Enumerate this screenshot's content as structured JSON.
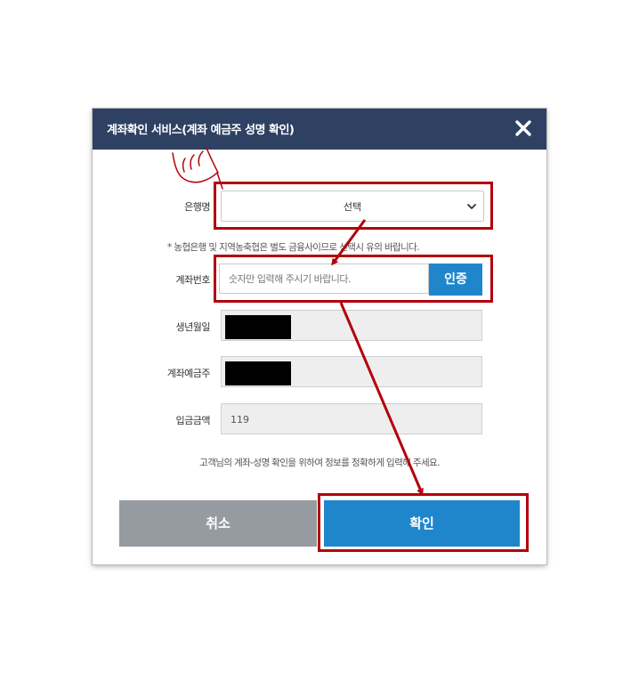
{
  "dialog": {
    "title": "계좌확인 서비스(계좌 예금주 성명 확인)",
    "close_icon": "close-icon"
  },
  "bank": {
    "label": "은행명",
    "selected": "선택"
  },
  "notice": "* 농협은행 및 지역농축협은 별도 금융사이므로 선택시 유의 바랍니다.",
  "account": {
    "label": "계좌번호",
    "placeholder": "숫자만 입력해 주시기 바랍니다.",
    "verify_label": "인증"
  },
  "birthdate": {
    "label": "생년월일"
  },
  "holder": {
    "label": "계좌예금주"
  },
  "amount": {
    "label": "입금금액",
    "value": "119"
  },
  "bottom_notice": "고객님의 계좌-성명 확인을 위하여 정보를 정확하게 입력해 주세요.",
  "buttons": {
    "cancel": "취소",
    "confirm": "확인"
  },
  "colors": {
    "header": "#2f4163",
    "primary": "#1f86cc",
    "cancel": "#969ba1",
    "highlight": "#b3000d"
  }
}
